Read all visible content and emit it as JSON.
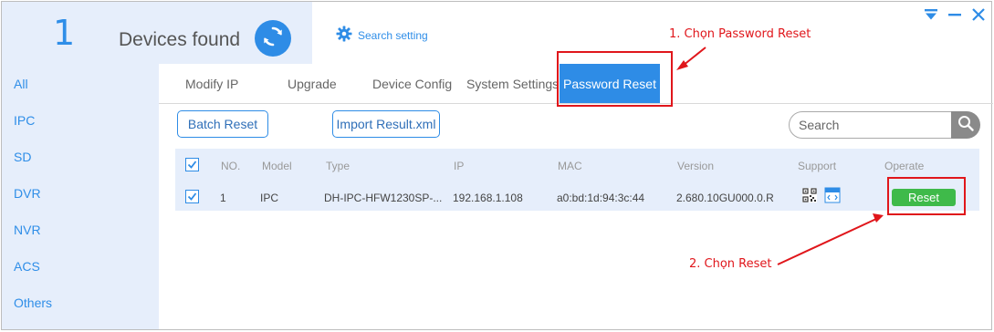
{
  "header": {
    "count": "1",
    "count_label": "Devices found",
    "search_setting": "Search setting",
    "refresh_icon": "refresh-icon",
    "gear_icon": "gear-icon"
  },
  "window_controls": [
    "dropdown-icon",
    "minimize-icon",
    "close-icon"
  ],
  "sidebar": {
    "items": [
      {
        "label": "All"
      },
      {
        "label": "IPC"
      },
      {
        "label": "SD"
      },
      {
        "label": "DVR"
      },
      {
        "label": "NVR"
      },
      {
        "label": "ACS"
      },
      {
        "label": "Others"
      }
    ]
  },
  "tabs": [
    {
      "label": "Modify IP"
    },
    {
      "label": "Upgrade"
    },
    {
      "label": "Device Config"
    },
    {
      "label": "System Settings"
    },
    {
      "label": "Password Reset",
      "active": true
    }
  ],
  "toolbar": {
    "batch_reset": "Batch Reset",
    "import_result": "Import Result.xml",
    "search_placeholder": "Search"
  },
  "table": {
    "headers": [
      "NO.",
      "Model",
      "Type",
      "IP",
      "MAC",
      "Version",
      "Support",
      "Operate"
    ],
    "rows": [
      {
        "no": "1",
        "model": "IPC",
        "type": "DH-IPC-HFW1230SP-...",
        "ip": "192.168.1.108",
        "mac": "a0:bd:1d:94:3c:44",
        "version": "2.680.10GU000.0.R",
        "support_icons": [
          "qr-code-icon",
          "xml-file-icon"
        ],
        "operate": "Reset",
        "checked": true
      }
    ],
    "header_checked": true
  },
  "annotations": {
    "step1": "1. Chọn Password Reset",
    "step2": "2. Chọn Reset"
  },
  "colors": {
    "accent": "#2e8ce6",
    "sidebar_bg": "#e6eefb",
    "reset_green": "#3fba4a",
    "annotation_red": "#e0161b"
  }
}
